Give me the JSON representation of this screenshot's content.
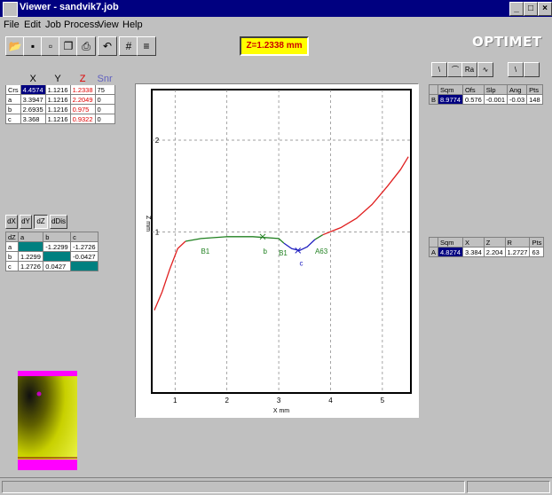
{
  "window": {
    "title": "Viewer - sandvik7.job",
    "minimize": "_",
    "maximize": "□",
    "close": "×"
  },
  "menu": [
    "File",
    "Edit",
    "Job",
    "Process",
    "View",
    "Help"
  ],
  "z_readout": "Z=1.2338 mm",
  "logo": "OPTIMET",
  "cursor_table": {
    "headers": [
      "",
      "X",
      "Y",
      "Z",
      "Snr"
    ],
    "rows": [
      [
        "Crs",
        "4.4574",
        "1.1216",
        "1.2338",
        "75"
      ],
      [
        "a",
        "3.3947",
        "1.1216",
        "2.2049",
        "0"
      ],
      [
        "b",
        "2.6935",
        "1.1216",
        "0.975",
        "0"
      ],
      [
        "c",
        "3.368",
        "1.1216",
        "0.9322",
        "0"
      ]
    ]
  },
  "delta_tabs": [
    "dX",
    "dY",
    "dZ",
    "dDis"
  ],
  "delta_table": {
    "headers": [
      "dZ",
      "a",
      "b",
      "c"
    ],
    "rows": [
      [
        "a",
        "",
        "-1.2299",
        "-1.2726"
      ],
      [
        "b",
        "1.2299",
        "",
        "-0.0427"
      ],
      [
        "c",
        "1.2726",
        "0.0427",
        ""
      ]
    ]
  },
  "right_tools": [
    "\\",
    "⌒",
    "Ra",
    "∿",
    "\\",
    ""
  ],
  "line_table": {
    "headers": [
      "",
      "Sqm",
      "Ofs",
      "Slp",
      "Ang",
      "Pts"
    ],
    "row": [
      "B",
      "8.9774",
      "0.576",
      "-0.001",
      "-0.03",
      "148"
    ]
  },
  "arc_table": {
    "headers": [
      "",
      "Sqm",
      "X",
      "Z",
      "R",
      "Pts"
    ],
    "row": [
      "A",
      "4.8274",
      "3.384",
      "2.204",
      "1.2727",
      "63"
    ]
  },
  "chart_data": {
    "type": "line",
    "xlabel": "X mm",
    "ylabel": "Z mm",
    "xlim": [
      0.55,
      5.55
    ],
    "ylim": [
      -0.75,
      2.55
    ],
    "x_ticks": [
      1,
      2,
      3,
      4,
      5
    ],
    "y_ticks": [
      1,
      2
    ],
    "grid": true,
    "series": [
      {
        "color": "#e02020",
        "x": [
          0.6,
          0.75,
          0.9,
          1.05,
          1.2
        ],
        "y": [
          0.15,
          0.35,
          0.6,
          0.82,
          0.9
        ]
      },
      {
        "color": "#208020",
        "x": [
          1.2,
          1.5,
          2.0,
          2.5,
          3.0,
          3.1
        ],
        "y": [
          0.9,
          0.93,
          0.95,
          0.95,
          0.93,
          0.88
        ]
      },
      {
        "color": "#2020c0",
        "x": [
          3.1,
          3.25,
          3.4,
          3.55,
          3.7
        ],
        "y": [
          0.88,
          0.82,
          0.8,
          0.84,
          0.92
        ]
      },
      {
        "color": "#208020",
        "x": [
          3.7,
          3.85
        ],
        "y": [
          0.92,
          0.97
        ]
      },
      {
        "color": "#e02020",
        "x": [
          3.85,
          4.2,
          4.5,
          4.8,
          5.1,
          5.35,
          5.5
        ],
        "y": [
          0.97,
          1.05,
          1.15,
          1.3,
          1.5,
          1.68,
          1.82
        ]
      }
    ],
    "annotations": [
      {
        "label": "B1",
        "x": 1.5,
        "y": 0.86,
        "color": "#208020"
      },
      {
        "label": "b",
        "x": 2.7,
        "y": 0.86,
        "color": "#208020"
      },
      {
        "label": "B1",
        "x": 3.0,
        "y": 0.84,
        "color": "#208020"
      },
      {
        "label": "c",
        "x": 3.4,
        "y": 0.73,
        "color": "#2020c0"
      },
      {
        "label": "A63",
        "x": 3.7,
        "y": 0.86,
        "color": "#208020"
      }
    ],
    "markers": [
      {
        "x": 2.69,
        "y": 0.95,
        "color": "#208020"
      },
      {
        "x": 3.37,
        "y": 0.8,
        "color": "#2020c0"
      }
    ]
  },
  "colors": {
    "titlebar": "#000080",
    "panel": "#c0c0c0",
    "readout": "#ffff00",
    "teal": "#008080"
  }
}
